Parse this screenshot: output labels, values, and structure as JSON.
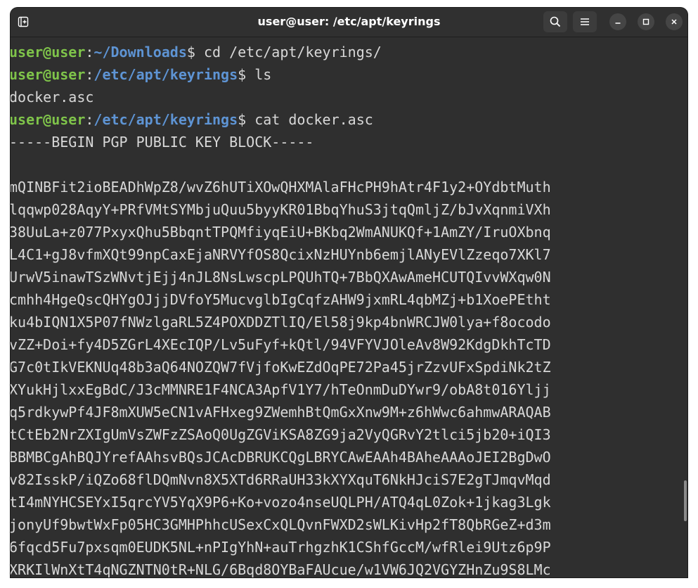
{
  "window": {
    "title": "user@user: /etc/apt/keyrings"
  },
  "icons": {
    "new_tab": "new-tab-icon",
    "search": "search-icon",
    "menu": "hamburger-menu-icon",
    "minimize": "minimize-icon",
    "maximize": "maximize-icon",
    "close": "close-icon"
  },
  "colors": {
    "prompt_user": "#7fc44a",
    "prompt_path": "#5e94d4",
    "text": "#d8d8d8",
    "background": "#2f2f2f"
  },
  "terminal": {
    "prompts": [
      {
        "user": "user@user",
        "sep": ":",
        "path": "~/Downloads",
        "sym": "$",
        "cmd": " cd /etc/apt/keyrings/"
      },
      {
        "user": "user@user",
        "sep": ":",
        "path": "/etc/apt/keyrings",
        "sym": "$",
        "cmd": " ls"
      },
      {
        "user": "user@user",
        "sep": ":",
        "path": "/etc/apt/keyrings",
        "sym": "$",
        "cmd": " cat docker.asc"
      }
    ],
    "ls_output": "docker.asc",
    "begin_line": "-----BEGIN PGP PUBLIC KEY BLOCK-----",
    "key_lines": [
      "mQINBFit2ioBEADhWpZ8/wvZ6hUTiXOwQHXMAlaFHcPH9hAtr4F1y2+OYdbtMuth",
      "lqqwp028AqyY+PRfVMtSYMbjuQuu5byyKR01BbqYhuS3jtqQmljZ/bJvXqnmiVXh",
      "38UuLa+z077PxyxQhu5BbqntTPQMfiyqEiU+BKbq2WmANUKQf+1AmZY/IruOXbnq",
      "L4C1+gJ8vfmXQt99npCaxEjaNRVYfOS8QcixNzHUYnb6emjlANyEVlZzeqo7XKl7",
      "UrwV5inawTSzWNvtjEjj4nJL8NsLwscpLPQUhTQ+7BbQXAwAmeHCUTQIvvWXqw0N",
      "cmhh4HgeQscQHYgOJjjDVfoY5MucvglbIgCqfzAHW9jxmRL4qbMZj+b1XoePEtht",
      "ku4bIQN1X5P07fNWzlgaRL5Z4POXDDZTlIQ/El58j9kp4bnWRCJW0lya+f8ocodo",
      "vZZ+Doi+fy4D5ZGrL4XEcIQP/Lv5uFyf+kQtl/94VFYVJOleAv8W92KdgDkhTcTD",
      "G7c0tIkVEKNUq48b3aQ64NOZQW7fVjfoKwEZdOqPE72Pa45jrZzvUFxSpdiNk2tZ",
      "XYukHjlxxEgBdC/J3cMMNRE1F4NCA3ApfV1Y7/hTeOnmDuDYwr9/obA8t016Yljj",
      "q5rdkywPf4JF8mXUW5eCN1vAFHxeg9ZWemhBtQmGxXnw9M+z6hWwc6ahmwARAQAB",
      "tCtEb2NrZXIgUmVsZWFzZSAoQ0UgZGViKSA8ZG9ja2VyQGRvY2tlci5jb20+iQI3",
      "BBMBCgAhBQJYrefAAhsvBQsJCAcDBRUKCQgLBRYCAwEAAh4BAheAAAoJEI2BgDwO",
      "v82IsskP/iQZo68flDQmNvn8X5XTd6RRaUH33kXYXquT6NkHJciS7E2gTJmqvMqd",
      "tI4mNYHCSEYxI5qrcYV5YqX9P6+Ko+vozo4nseUQLPH/ATQ4qL0Zok+1jkag3Lgk",
      "jonyUf9bwtWxFp05HC3GMHPhhcUSexCxQLQvnFWXD2sWLKivHp2fT8QbRGeZ+d3m",
      "6fqcd5Fu7pxsqm0EUDK5NL+nPIgYhN+auTrhgzhK1CShfGccM/wfRlei9Utz6p9P",
      "XRKIlWnXtT4qNGZNTN0tR+NLG/6Bqd8OYBaFAUcue/w1VW6JQ2VGYZHnZu9S8LMc"
    ]
  }
}
